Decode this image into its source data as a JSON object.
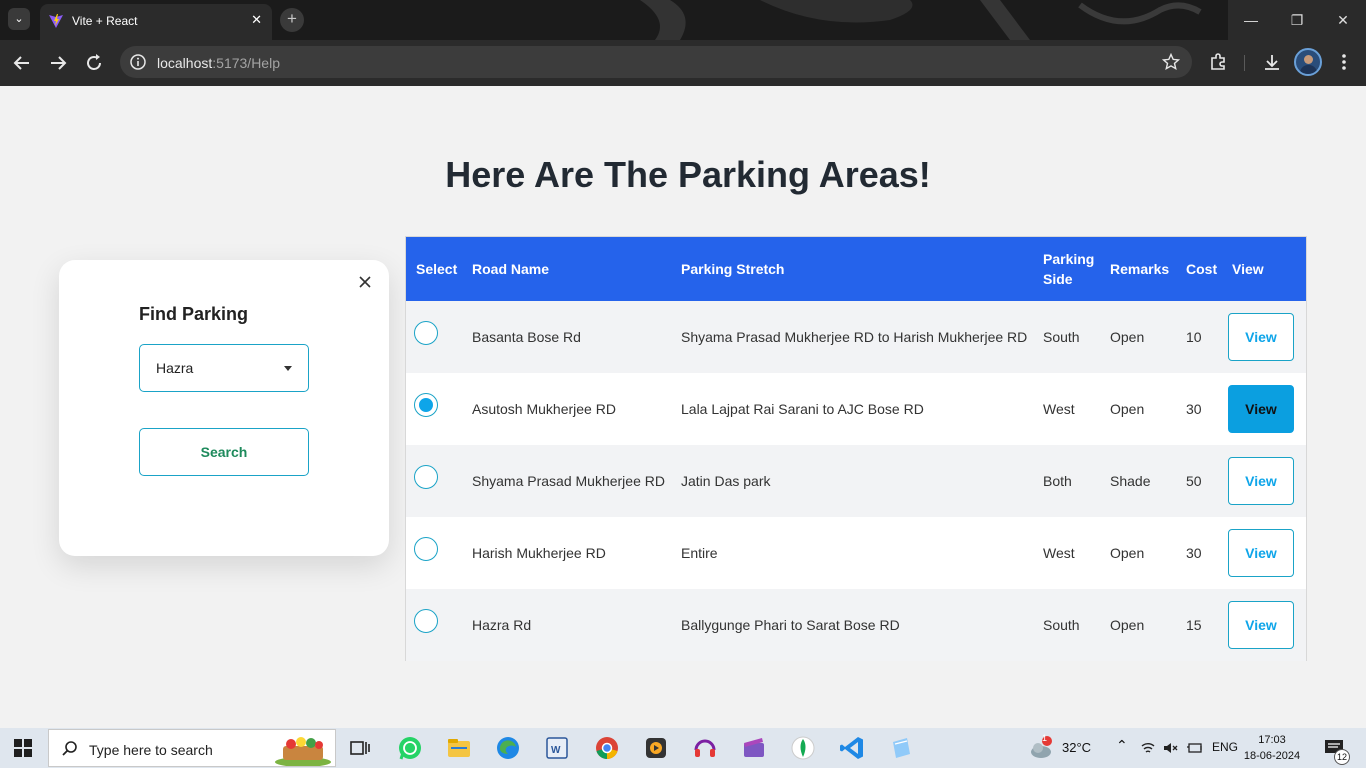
{
  "browser": {
    "tab_title": "Vite + React",
    "url_host": "localhost",
    "url_path": ":5173/Help"
  },
  "page": {
    "title": "Here Are The Parking Areas!"
  },
  "find_card": {
    "heading": "Find Parking",
    "selected_area": "Hazra",
    "search_label": "Search"
  },
  "table": {
    "headers": {
      "select": "Select",
      "road": "Road Name",
      "stretch": "Parking Stretch",
      "side_line1": "Parking",
      "side_line2": "Side",
      "remarks": "Remarks",
      "cost": "Cost",
      "view": "View"
    },
    "rows": [
      {
        "road": "Basanta Bose Rd",
        "stretch": "Shyama Prasad Mukherjee RD to Harish Mukherjee RD",
        "side": "South",
        "remarks": "Open",
        "cost": "10",
        "view": "View",
        "selected": false
      },
      {
        "road": "Asutosh Mukherjee RD",
        "stretch": "Lala Lajpat Rai Sarani to AJC Bose RD",
        "side": "West",
        "remarks": "Open",
        "cost": "30",
        "view": "View",
        "selected": true
      },
      {
        "road": "Shyama Prasad Mukherjee RD",
        "stretch": "Jatin Das park",
        "side": "Both",
        "remarks": "Shade",
        "cost": "50",
        "view": "View",
        "selected": false
      },
      {
        "road": "Harish Mukherjee RD",
        "stretch": "Entire",
        "side": "West",
        "remarks": "Open",
        "cost": "30",
        "view": "View",
        "selected": false
      },
      {
        "road": "Hazra Rd",
        "stretch": "Ballygunge Phari to Sarat Bose RD",
        "side": "South",
        "remarks": "Open",
        "cost": "15",
        "view": "View",
        "selected": false
      }
    ]
  },
  "taskbar": {
    "search_placeholder": "Type here to search",
    "weather_temp": "32°C",
    "weather_badge": "1",
    "language": "ENG",
    "time": "17:03",
    "date": "18-06-2024",
    "notification_count": "12"
  },
  "colors": {
    "table_header": "#2563eb",
    "accent": "#0ea5e9",
    "search_text": "#1e8a5c"
  }
}
